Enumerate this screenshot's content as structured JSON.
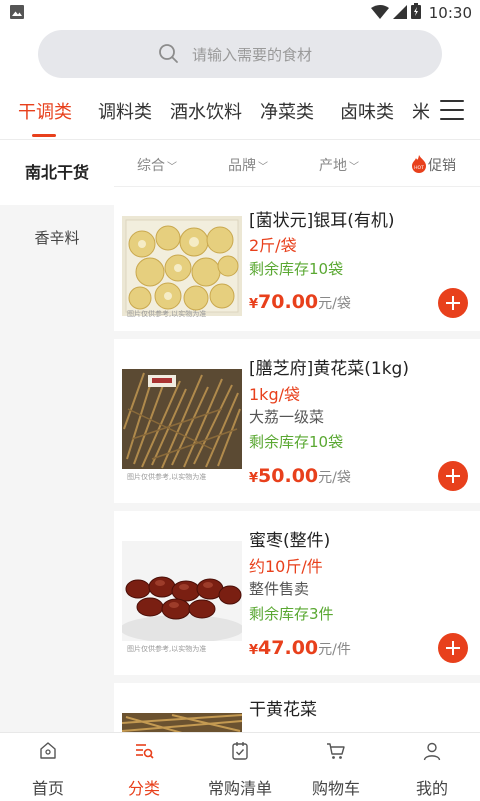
{
  "status_bar": {
    "time": "10:30"
  },
  "search": {
    "placeholder": "请输入需要的食材"
  },
  "category_tabs": [
    {
      "label": "干调类",
      "active": true
    },
    {
      "label": "调料类",
      "active": false
    },
    {
      "label": "酒水饮料",
      "active": false
    },
    {
      "label": "净菜类",
      "active": false
    },
    {
      "label": "卤味类",
      "active": false
    },
    {
      "label": "米",
      "active": false
    }
  ],
  "sidebar": {
    "items": [
      {
        "label": "南北干货",
        "active": true
      },
      {
        "label": "香辛料",
        "active": false
      }
    ]
  },
  "filters": {
    "comprehensive": "综合",
    "brand": "品牌",
    "origin": "产地",
    "promotion": "促销",
    "hot_badge": "HOT"
  },
  "products": [
    {
      "title": "[菌状元]银耳(有机)",
      "spec": "2斤/袋",
      "subtitle": "",
      "stock": "剩余库存10袋",
      "currency": "¥",
      "price": "70.00",
      "price_unit": "元/袋",
      "image_note": "图片仅供参考,以实物为准",
      "image_icon": "white-fungus-photo"
    },
    {
      "title": "[膳芝府]黄花菜(1kg)",
      "spec": "1kg/袋",
      "subtitle": "大荔一级菜",
      "stock": "剩余库存10袋",
      "currency": "¥",
      "price": "50.00",
      "price_unit": "元/袋",
      "image_note": "图片仅供参考,以实物为准",
      "image_icon": "daylily-photo"
    },
    {
      "title": "蜜枣(整件)",
      "spec": "约10斤/件",
      "subtitle": "整件售卖",
      "stock": "剩余库存3件",
      "currency": "¥",
      "price": "47.00",
      "price_unit": "元/件",
      "image_note": "图片仅供参考,以实物为准",
      "image_icon": "candied-dates-photo"
    },
    {
      "title": "干黄花菜",
      "spec": "",
      "subtitle": "",
      "stock": "",
      "currency": "",
      "price": "",
      "price_unit": "",
      "image_note": "",
      "image_icon": "dried-daylily-photo"
    }
  ],
  "bottom_nav": [
    {
      "label": "首页",
      "icon": "home-icon",
      "active": false
    },
    {
      "label": "分类",
      "icon": "category-icon",
      "active": true
    },
    {
      "label": "常购清单",
      "icon": "shopping-list-icon",
      "active": false
    },
    {
      "label": "购物车",
      "icon": "cart-icon",
      "active": false
    },
    {
      "label": "我的",
      "icon": "profile-icon",
      "active": false
    }
  ],
  "colors": {
    "accent": "#e8401c",
    "stock_green": "#5aa832",
    "sidebar_bg": "#f5f5f5",
    "search_bg": "#e6e7eb"
  }
}
